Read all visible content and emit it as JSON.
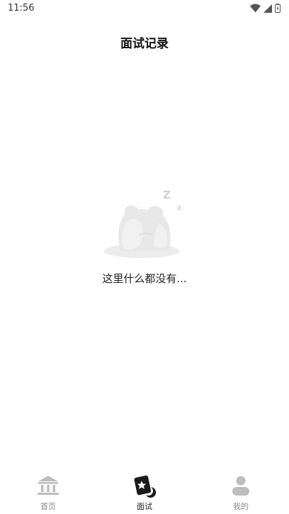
{
  "status_bar": {
    "time": "11:56",
    "icons": [
      "wifi-icon",
      "signal-icon",
      "battery-icon"
    ]
  },
  "page": {
    "title": "面试记录"
  },
  "empty_state": {
    "illustration": "sleeping-frog-icon",
    "sleep_marks": [
      "Z",
      "z"
    ],
    "message": "这里什么都没有..."
  },
  "tab_bar": {
    "active": "interview",
    "tabs": [
      {
        "id": "home",
        "label": "首页",
        "icon": "bank-icon"
      },
      {
        "id": "interview",
        "label": "面试",
        "icon": "interview-card-icon"
      },
      {
        "id": "mine",
        "label": "我的",
        "icon": "user-icon"
      }
    ]
  },
  "colors": {
    "background": "#ffffff",
    "active_tab": "#222222",
    "inactive_tab": "#888888",
    "illustration": "#ebebeb"
  }
}
